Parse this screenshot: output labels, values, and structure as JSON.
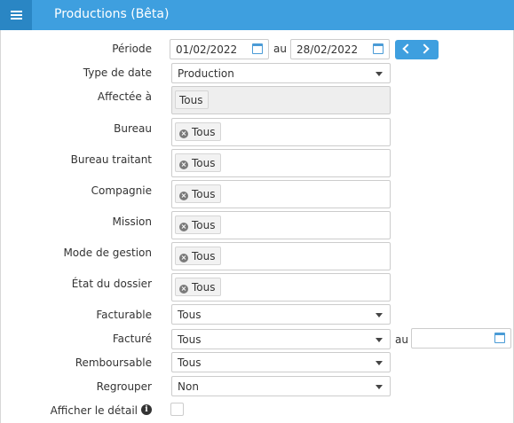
{
  "header": {
    "title": "Productions (Bêta)"
  },
  "periode": {
    "label": "Période",
    "from": "01/02/2022",
    "sep": "au",
    "to": "28/02/2022"
  },
  "type_date": {
    "label": "Type de date",
    "value": "Production"
  },
  "affectee": {
    "label": "Affectée à",
    "tag": "Tous"
  },
  "bureau": {
    "label": "Bureau",
    "tag": "Tous"
  },
  "bureau_traitant": {
    "label": "Bureau traitant",
    "tag": "Tous"
  },
  "compagnie": {
    "label": "Compagnie",
    "tag": "Tous"
  },
  "mission": {
    "label": "Mission",
    "tag": "Tous"
  },
  "mode_gestion": {
    "label": "Mode de gestion",
    "tag": "Tous"
  },
  "etat_dossier": {
    "label": "État du dossier",
    "tag": "Tous"
  },
  "facturable": {
    "label": "Facturable",
    "value": "Tous"
  },
  "facture": {
    "label": "Facturé",
    "value": "Tous",
    "sep": "au",
    "date": ""
  },
  "remboursable": {
    "label": "Remboursable",
    "value": "Tous"
  },
  "regrouper": {
    "label": "Regrouper",
    "value": "Non"
  },
  "afficher_detail": {
    "label": "Afficher le détail",
    "checked": false
  },
  "icons": {
    "menu": "hamburger-menu-icon",
    "calendar": "calendar-icon",
    "prev": "chevron-left-icon",
    "next": "chevron-right-icon",
    "remove": "remove-tag-icon",
    "dropdown": "caret-down-icon",
    "info": "info-icon"
  },
  "colors": {
    "header": "#3e9fdf",
    "menu_button": "#2a86c4",
    "accent": "#4a9bd6"
  }
}
